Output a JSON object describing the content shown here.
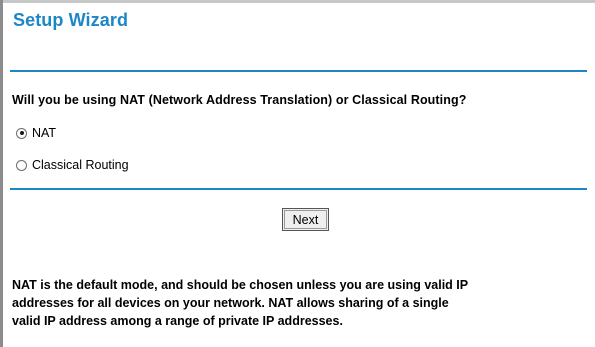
{
  "wizard": {
    "title": "Setup Wizard"
  },
  "question": {
    "text": "Will you be using NAT (Network Address Translation) or Classical Routing?"
  },
  "options": [
    {
      "label": "NAT",
      "selected": true
    },
    {
      "label": "Classical Routing",
      "selected": false
    }
  ],
  "actions": {
    "next_label": "Next"
  },
  "info": {
    "lines": [
      "NAT is the default mode, and should be chosen unless you are using valid IP",
      "addresses for all devices on your network. NAT allows sharing of a single",
      "valid IP address among a range of private IP addresses."
    ]
  },
  "colors": {
    "accent": "#1d86c6"
  }
}
